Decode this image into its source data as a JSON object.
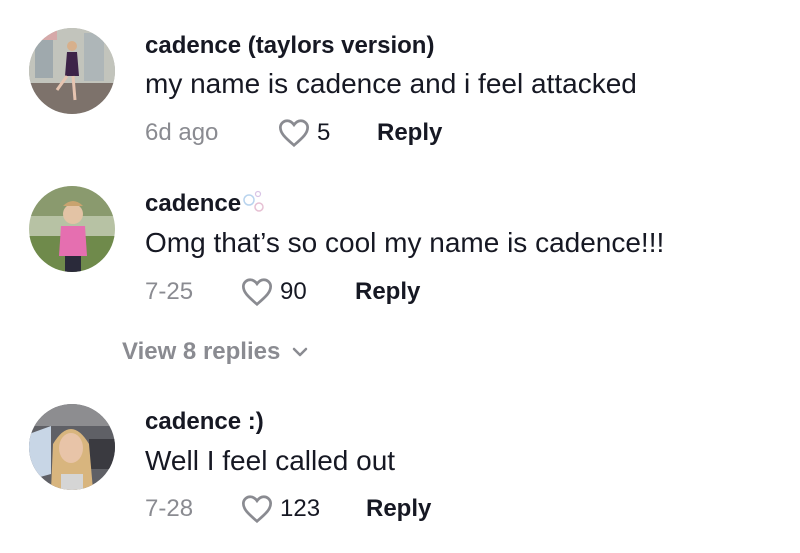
{
  "comments": [
    {
      "username": "cadence (taylors version)",
      "text": "my name is cadence and i feel attacked",
      "date": "6d ago",
      "likes": "5",
      "reply_label": "Reply",
      "avatar_icon": "avatar-photo"
    },
    {
      "username": "cadence",
      "username_badge": "bubbles-emoji",
      "text": "Omg that’s so cool my name is cadence!!!",
      "date": "7-25",
      "likes": "90",
      "reply_label": "Reply",
      "avatar_icon": "avatar-photo"
    },
    {
      "username": "cadence :)",
      "text": "Well I feel called out",
      "date": "7-28",
      "likes": "123",
      "reply_label": "Reply",
      "avatar_icon": "avatar-photo"
    }
  ],
  "view_replies": {
    "label": "View 8 replies",
    "icon": "chevron-down-icon"
  },
  "colors": {
    "primary_text": "#161823",
    "secondary_text": "#8a8b91",
    "heart_outline": "#8a8b91"
  }
}
